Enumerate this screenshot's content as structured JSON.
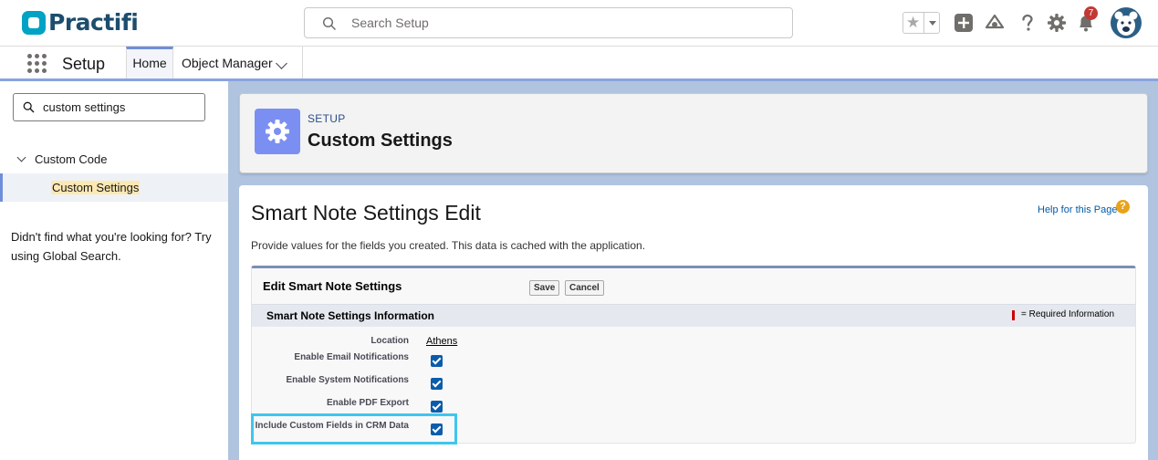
{
  "header": {
    "logo_text": "Practifi",
    "search_placeholder": "Search Setup",
    "notification_count": "7"
  },
  "nav": {
    "app_name": "Setup",
    "tabs": [
      {
        "label": "Home"
      },
      {
        "label": "Object Manager"
      }
    ]
  },
  "sidebar": {
    "quick_find_value": "custom settings",
    "tree_group": "Custom Code",
    "tree_item": "Custom Settings",
    "not_found": "Didn't find what you're looking for? Try using Global Search."
  },
  "page_header": {
    "breadcrumb": "SETUP",
    "title": "Custom Settings"
  },
  "main": {
    "title": "Smart Note Settings Edit",
    "help_link": "Help for this Page",
    "help_icon_glyph": "?",
    "description": "Provide values for the fields you created. This data is cached with the application.",
    "edit_block": {
      "title": "Edit Smart Note Settings",
      "save_label": "Save",
      "cancel_label": "Cancel",
      "section_title": "Smart Note Settings Information",
      "required_text": "= Required Information",
      "fields": [
        {
          "label": "Location",
          "value": "Athens"
        },
        {
          "label": "Enable Email Notifications",
          "checked": true
        },
        {
          "label": "Enable System Notifications",
          "checked": true
        },
        {
          "label": "Enable PDF Export",
          "checked": true
        },
        {
          "label": "Include Custom Fields in CRM Data",
          "checked": true
        }
      ]
    }
  },
  "colors": {
    "brand": "#1c4d6e",
    "accent": "#6f8ed9",
    "checkbox": "#0b5cab",
    "highlight": "#3ec6ee"
  }
}
